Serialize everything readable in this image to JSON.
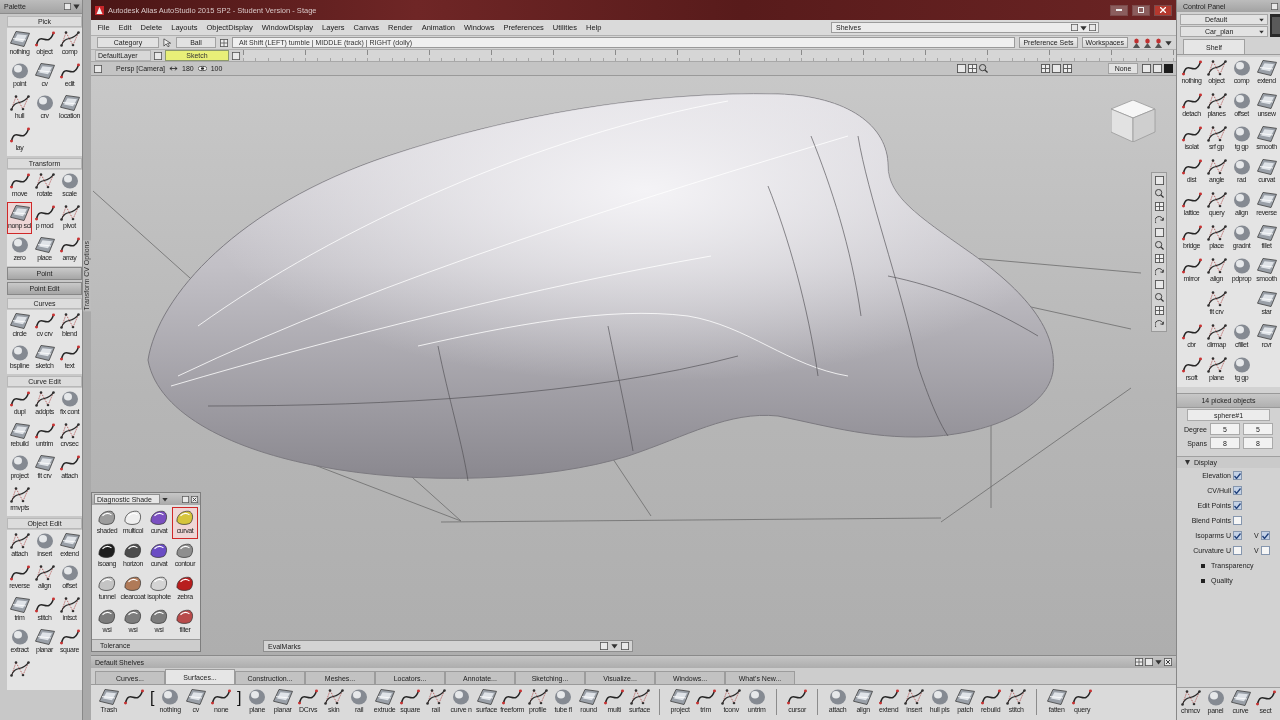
{
  "title_bar": {
    "title": "Autodesk Alias AutoStudio 2015 SP2 - Student Version - Stage"
  },
  "menu_bar": {
    "items": [
      "File",
      "Edit",
      "Delete",
      "Layouts",
      "ObjectDisplay",
      "WindowDisplay",
      "Layers",
      "Canvas",
      "Render",
      "Animation",
      "Windows",
      "Preferences",
      "Utilities",
      "Help"
    ],
    "shelves_field": "Shelves"
  },
  "tool_row": {
    "category": "Category",
    "mode": "Ball",
    "mouse_hint": "Alt Shift (LEFT) tumble | MIDDLE (track) | RIGHT (dolly)",
    "buttons": [
      "Preference Sets",
      "Workspaces"
    ]
  },
  "layer_bar": {
    "default_layer": "DefaultLayer",
    "layer": "Sketch"
  },
  "view_header": {
    "camera": "Persp [Camera]",
    "angle": "180",
    "eye": "100",
    "display_mode": "None"
  },
  "palette": {
    "title": "Palette",
    "sections": [
      {
        "title": "Pick",
        "expanded": true,
        "tools": [
          {
            "label": "nothing",
            "selected": false
          },
          {
            "label": "object",
            "selected": false
          },
          {
            "label": "comp",
            "selected": false
          },
          {
            "label": "point",
            "selected": false
          },
          {
            "label": "cv",
            "selected": false
          },
          {
            "label": "edit",
            "selected": false
          },
          {
            "label": "hull",
            "selected": false
          },
          {
            "label": "crv",
            "selected": false
          },
          {
            "label": "location",
            "selected": false
          },
          {
            "label": "lay",
            "selected": false
          }
        ]
      },
      {
        "title": "Transform",
        "expanded": true,
        "tools": [
          {
            "label": "move",
            "selected": false
          },
          {
            "label": "rotate",
            "selected": false
          },
          {
            "label": "scale",
            "selected": false
          },
          {
            "label": "nonp scl",
            "selected": true
          },
          {
            "label": "p mod",
            "selected": false
          },
          {
            "label": "pivot",
            "selected": false
          },
          {
            "label": "zero",
            "selected": false
          },
          {
            "label": "place",
            "selected": false
          },
          {
            "label": "array",
            "selected": false
          }
        ]
      },
      {
        "title": "Point",
        "expanded": false
      },
      {
        "title": "Point Edit",
        "expanded": false
      },
      {
        "title": "Curves",
        "expanded": true,
        "tools": [
          {
            "label": "circle",
            "selected": false
          },
          {
            "label": "cv crv",
            "selected": false
          },
          {
            "label": "blend",
            "selected": false
          },
          {
            "label": "bspline",
            "selected": false
          },
          {
            "label": "sketch",
            "selected": false
          },
          {
            "label": "text",
            "selected": false
          }
        ]
      },
      {
        "title": "Curve Edit",
        "expanded": true,
        "tools": [
          {
            "label": "dupl",
            "selected": false
          },
          {
            "label": "addpts",
            "selected": false
          },
          {
            "label": "fix cont",
            "selected": false
          },
          {
            "label": "rebuild",
            "selected": false
          },
          {
            "label": "untrim",
            "selected": false
          },
          {
            "label": "crvsec",
            "selected": false
          },
          {
            "label": "project",
            "selected": false
          },
          {
            "label": "fit crv",
            "selected": false
          },
          {
            "label": "attach",
            "selected": false
          },
          {
            "label": "rmvpts",
            "selected": false
          }
        ]
      },
      {
        "title": "Object Edit",
        "expanded": true,
        "tools": [
          {
            "label": "attach",
            "selected": false
          },
          {
            "label": "insert",
            "selected": false
          },
          {
            "label": "extend",
            "selected": false
          },
          {
            "label": "reverse",
            "selected": false
          },
          {
            "label": "align",
            "selected": false
          },
          {
            "label": "offset",
            "selected": false
          },
          {
            "label": "trim",
            "selected": false
          },
          {
            "label": "stitch",
            "selected": false
          },
          {
            "label": "intsct",
            "selected": false
          },
          {
            "label": "extract",
            "selected": false
          },
          {
            "label": "planar",
            "selected": false
          },
          {
            "label": "square",
            "selected": false
          },
          {
            "selected": false
          }
        ]
      }
    ]
  },
  "side_tab": "Transform CV Options",
  "diagnostic_shade": {
    "title": "Diagnostic Shade",
    "modes": [
      {
        "label": "shaded",
        "selected": false
      },
      {
        "label": "multicol",
        "selected": false
      },
      {
        "label": "curvat",
        "selected": false
      },
      {
        "label": "curvat",
        "selected": true
      },
      {
        "label": "isoang",
        "selected": false
      },
      {
        "label": "horizon",
        "selected": false
      },
      {
        "label": "curvat",
        "selected": false
      },
      {
        "label": "contour",
        "selected": false
      },
      {
        "label": "tunnel",
        "selected": false
      },
      {
        "label": "clearcoat",
        "selected": false
      },
      {
        "label": "isophote",
        "selected": false
      },
      {
        "label": "zebra",
        "selected": false
      },
      {
        "label": "wsi",
        "selected": false
      },
      {
        "label": "wsi",
        "selected": false
      },
      {
        "label": "wsi",
        "selected": false
      },
      {
        "label": "filter",
        "selected": false
      }
    ],
    "tolerance": "Tolerance"
  },
  "eval_bar": {
    "label": "EvalMarks"
  },
  "shelf": {
    "title": "Default Shelves",
    "tabs": [
      {
        "label": "Curves...",
        "selected": false
      },
      {
        "label": "Surfaces...",
        "selected": true
      },
      {
        "label": "Construction...",
        "selected": false
      },
      {
        "label": "Meshes...",
        "selected": false
      },
      {
        "label": "Locators...",
        "selected": false
      },
      {
        "label": "Annotate...",
        "selected": false
      },
      {
        "label": "Sketching...",
        "selected": false
      },
      {
        "label": "Visualize...",
        "selected": false
      },
      {
        "label": "Windows...",
        "selected": false
      },
      {
        "label": "What's New...",
        "selected": false
      }
    ],
    "tools": [
      {
        "kind": "tool",
        "label": "Trash"
      },
      {
        "kind": "tool"
      },
      {
        "kind": "bracket",
        "text": "["
      },
      {
        "kind": "tool",
        "label": "nothing"
      },
      {
        "kind": "tool",
        "label": "cv"
      },
      {
        "kind": "tool",
        "label": "none"
      },
      {
        "kind": "bracket",
        "text": "]"
      },
      {
        "kind": "tool",
        "label": "plane"
      },
      {
        "kind": "tool",
        "label": "planar"
      },
      {
        "kind": "tool",
        "label": "DCrvs"
      },
      {
        "kind": "tool",
        "label": "skin"
      },
      {
        "kind": "tool",
        "label": "rail"
      },
      {
        "kind": "tool",
        "label": "extrude"
      },
      {
        "kind": "tool",
        "label": "square"
      },
      {
        "kind": "tool",
        "label": "rail"
      },
      {
        "kind": "tool",
        "label": "curve n"
      },
      {
        "kind": "tool",
        "label": "surface"
      },
      {
        "kind": "tool",
        "label": "freeform"
      },
      {
        "kind": "tool",
        "label": "profile"
      },
      {
        "kind": "tool",
        "label": "tube fl"
      },
      {
        "kind": "tool",
        "label": "round"
      },
      {
        "kind": "tool",
        "label": "multi"
      },
      {
        "kind": "tool",
        "label": "surface"
      },
      {
        "kind": "separator"
      },
      {
        "kind": "tool",
        "label": "project"
      },
      {
        "kind": "tool",
        "label": "trim"
      },
      {
        "kind": "tool",
        "label": "tconv"
      },
      {
        "kind": "tool",
        "label": "untrim"
      },
      {
        "kind": "separator"
      },
      {
        "kind": "tool",
        "label": "cursor"
      },
      {
        "kind": "separator"
      },
      {
        "kind": "tool",
        "label": "attach"
      },
      {
        "kind": "tool",
        "label": "align"
      },
      {
        "kind": "tool",
        "label": "extend"
      },
      {
        "kind": "tool",
        "label": "insert"
      },
      {
        "kind": "tool",
        "label": "hull pls"
      },
      {
        "kind": "tool",
        "label": "patch"
      },
      {
        "kind": "tool",
        "label": "rebuild"
      },
      {
        "kind": "tool",
        "label": "stitch"
      },
      {
        "kind": "separator"
      },
      {
        "kind": "tool",
        "label": "fatten"
      },
      {
        "kind": "tool",
        "label": "query"
      }
    ]
  },
  "control_panel": {
    "title": "Control Panel",
    "presets": [
      "Default",
      "Car_plan"
    ],
    "tabs": [
      {
        "label": "Shelf",
        "selected": true
      }
    ],
    "tools": [
      {
        "kind": "tool",
        "label": "nothing"
      },
      {
        "kind": "tool",
        "label": "object"
      },
      {
        "kind": "tool",
        "label": "comp"
      },
      {
        "kind": "tool",
        "label": "extend"
      },
      {
        "kind": "tool",
        "label": "detach"
      },
      {
        "kind": "tool",
        "label": "planes"
      },
      {
        "kind": "tool",
        "label": "offset"
      },
      {
        "kind": "tool",
        "label": "unsew"
      },
      {
        "kind": "tool",
        "label": "isolat"
      },
      {
        "kind": "tool",
        "label": "srf gp"
      },
      {
        "kind": "tool",
        "label": "tg gp"
      },
      {
        "kind": "tool",
        "label": "smooth"
      },
      {
        "kind": "tool",
        "label": "dist"
      },
      {
        "kind": "tool",
        "label": "angle"
      },
      {
        "kind": "tool",
        "label": "rad"
      },
      {
        "kind": "tool",
        "label": "curvat"
      },
      {
        "kind": "tool",
        "label": "lattice"
      },
      {
        "kind": "tool",
        "label": "query"
      },
      {
        "kind": "tool",
        "label": "align"
      },
      {
        "kind": "tool",
        "label": "reverse"
      },
      {
        "kind": "tool",
        "label": "bridge"
      },
      {
        "kind": "tool",
        "label": "place"
      },
      {
        "kind": "tool",
        "label": "gradnt"
      },
      {
        "kind": "tool",
        "label": "fillet"
      },
      {
        "kind": "tool",
        "label": "mirror"
      },
      {
        "kind": "tool",
        "label": "align"
      },
      {
        "kind": "tool",
        "label": "pdprop"
      },
      {
        "kind": "tool",
        "label": "smooth"
      },
      {
        "kind": "blank"
      },
      {
        "kind": "tool",
        "label": "fit crv"
      },
      {
        "kind": "blank"
      },
      {
        "kind": "tool",
        "label": "star"
      },
      {
        "kind": "tool",
        "label": "cbr"
      },
      {
        "kind": "tool",
        "label": "dirmap"
      },
      {
        "kind": "tool",
        "label": "cfillet"
      },
      {
        "kind": "tool",
        "label": "rcvr"
      },
      {
        "kind": "tool",
        "label": "rsoft"
      },
      {
        "kind": "tool",
        "label": "plane"
      },
      {
        "kind": "tool",
        "label": "tg gp"
      }
    ],
    "selection": {
      "title": "14 picked objects",
      "object": "sphere#1",
      "fields": [
        {
          "label": "Degree",
          "values": [
            "5",
            "5"
          ]
        },
        {
          "label": "Spans",
          "values": [
            "8",
            "8"
          ]
        }
      ]
    },
    "display": {
      "title": "Display",
      "expanded": true,
      "options": [
        {
          "label": "Elevation",
          "checked": true
        },
        {
          "label": "CV/Hull",
          "checked": true
        },
        {
          "label": "Edit Points",
          "checked": true
        },
        {
          "label": "Blend Points",
          "checked": false
        },
        {
          "label": "Isoparms U",
          "checked": true,
          "second": {
            "label": "V",
            "checked": true
          }
        },
        {
          "label": "Curvature U",
          "checked": false,
          "second": {
            "label": "V",
            "checked": false
          }
        }
      ]
    },
    "sections": [
      {
        "title": "Transparency",
        "expanded": false
      },
      {
        "title": "Quality",
        "expanded": false
      }
    ],
    "bottom_tools": [
      "chmcv",
      "panel",
      "curve",
      "sect"
    ]
  }
}
